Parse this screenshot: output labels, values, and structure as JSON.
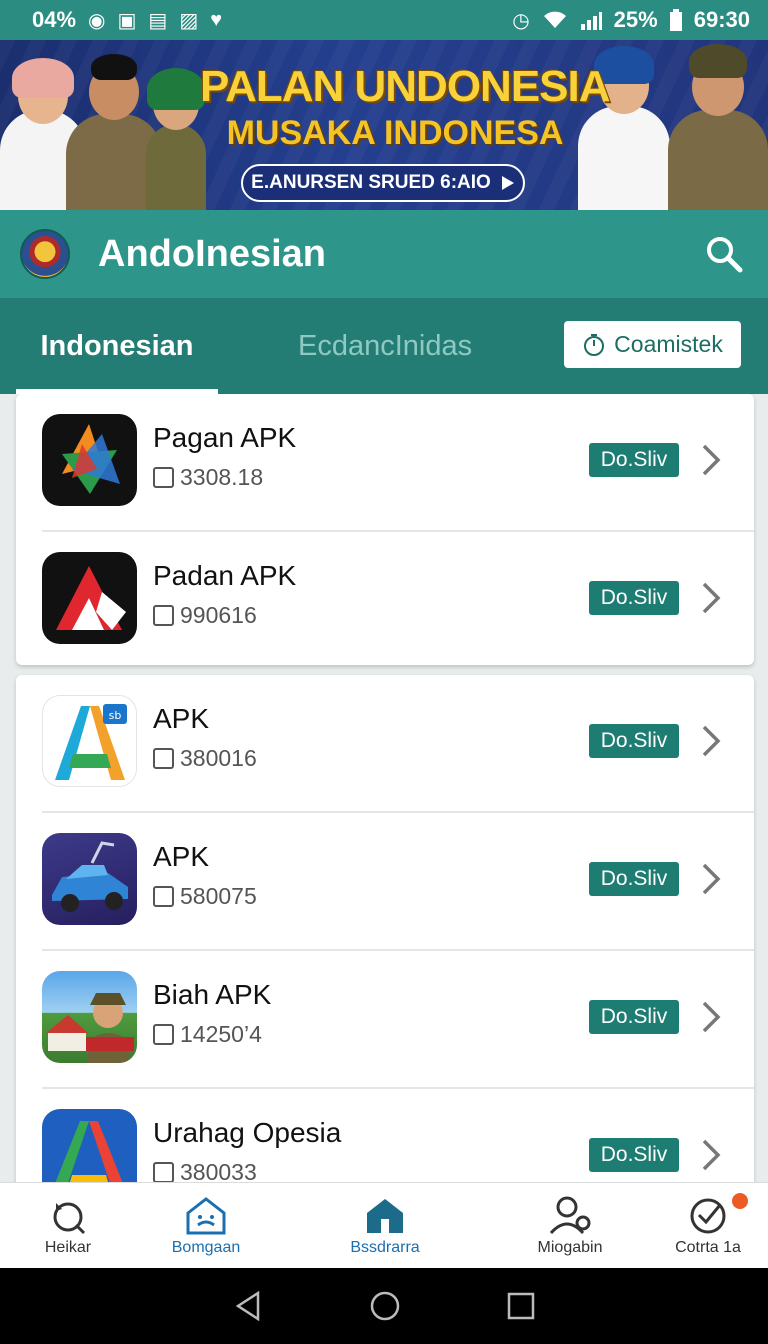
{
  "status_bar": {
    "left_text": "04%",
    "right_battery": "25%",
    "time": "69:30"
  },
  "banner": {
    "title": "PALAN UNDONESIA",
    "subtitle": "MUSAKA INDONESA",
    "cta": "E.ANURSEN SRUED 6:AIO"
  },
  "app_bar": {
    "title": "AndoInesian"
  },
  "tabs": {
    "active": "Indonesian",
    "inactive": "EcdancInidas",
    "filter_button": "Coamistek"
  },
  "list_group_1": [
    {
      "name": "Pagan APK",
      "meta": "3308.18",
      "badge": "Do.Sliv"
    },
    {
      "name": "Padan APK",
      "meta": "990616",
      "badge": "Do.Sliv"
    }
  ],
  "list_group_2": [
    {
      "name": "APK",
      "meta": "380016",
      "badge": "Do.Sliv"
    },
    {
      "name": "APK",
      "meta": "580075",
      "badge": "Do.Sliv"
    },
    {
      "name": "Biah APK",
      "meta": "14250’4",
      "badge": "Do.Sliv"
    },
    {
      "name": "Urahag Opesia",
      "meta": "380033",
      "badge": "Do.Sliv"
    }
  ],
  "bottom_nav": [
    {
      "label": "Heikar",
      "icon": "refresh-icon"
    },
    {
      "label": "Bomgaan",
      "icon": "home-outline-icon"
    },
    {
      "label": "Bssdrarra",
      "icon": "home-filled-icon"
    },
    {
      "label": "Miogabin",
      "icon": "profile-settings-icon"
    },
    {
      "label": "Cotrta 1a",
      "icon": "check-circle-icon"
    }
  ],
  "colors": {
    "primary": "#2e958a",
    "primary_dark": "#247d74",
    "badge": "#1e7d73",
    "nav_selected": "#1a6fb0",
    "notification": "#ec5b24"
  }
}
